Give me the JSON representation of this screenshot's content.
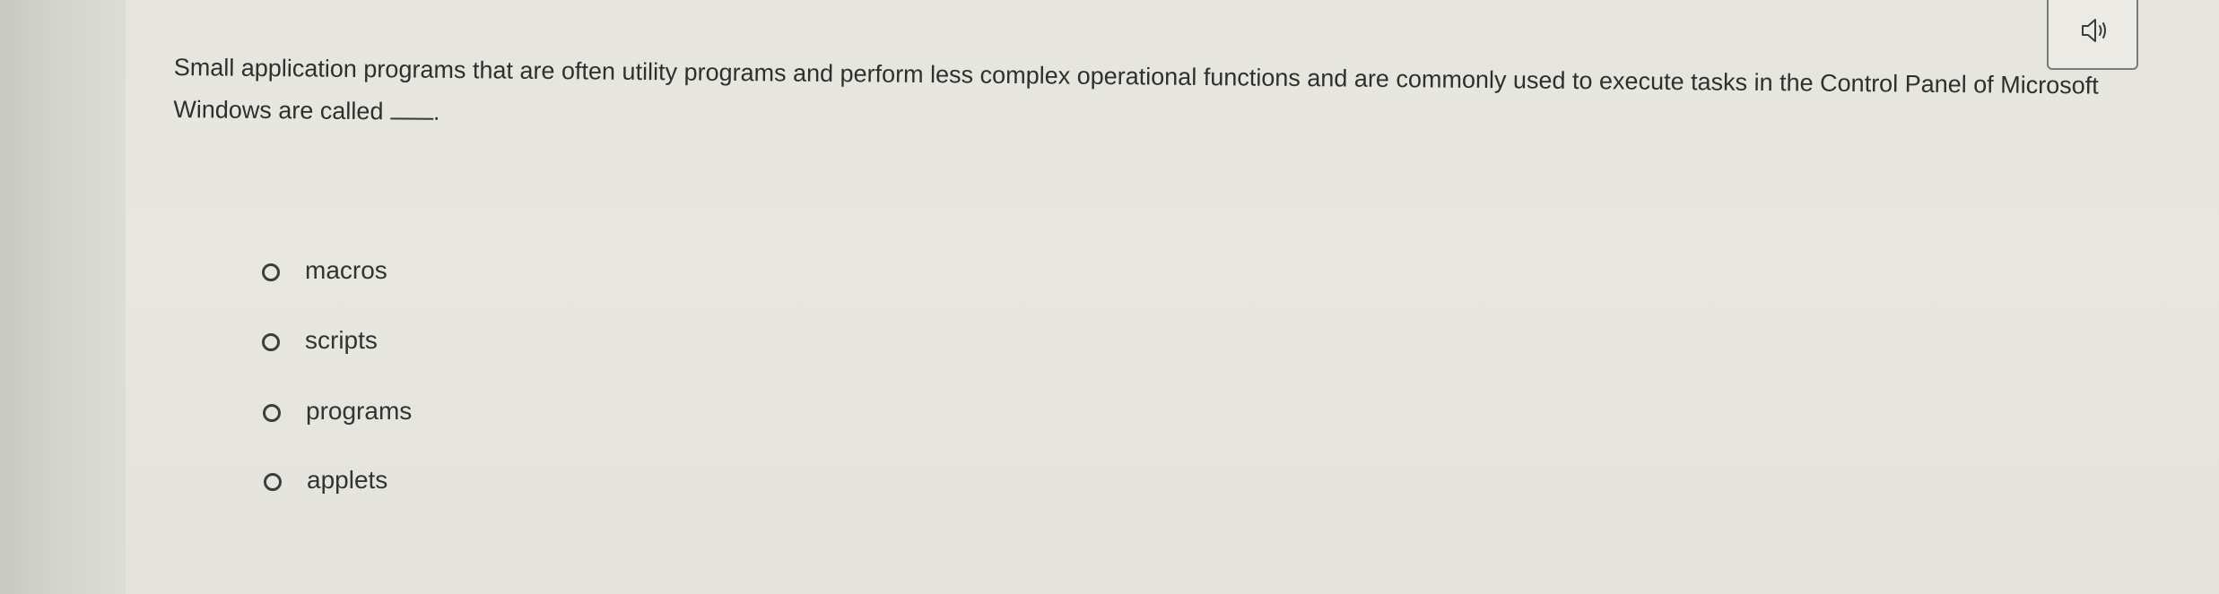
{
  "question": {
    "text": "Small application programs that are often utility programs and perform less complex operational functions and are commonly used to execute tasks in the Control Panel of Microsoft Windows are called",
    "end_punctuation": "."
  },
  "audio_button": {
    "icon": "speaker-icon"
  },
  "options": [
    {
      "label": "macros",
      "selected": false
    },
    {
      "label": "scripts",
      "selected": false
    },
    {
      "label": "programs",
      "selected": false
    },
    {
      "label": "applets",
      "selected": false
    }
  ]
}
